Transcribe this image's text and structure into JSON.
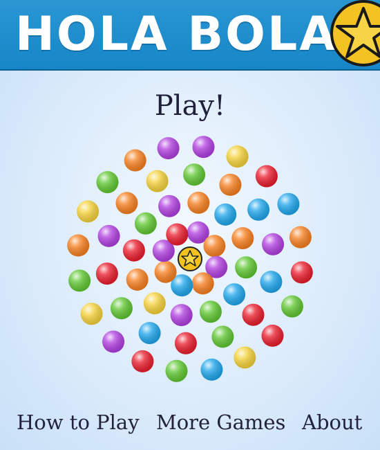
{
  "header": {
    "title": "Hola Bola!",
    "background": "#1b8bcc",
    "logo_icon": "star-ball-icon"
  },
  "main": {
    "play_label": "Play!"
  },
  "colors": {
    "violet": "#b03ee0",
    "yellow": "#f5d23a",
    "orange": "#f77f1f",
    "green": "#5fc731",
    "red": "#ea1c2c",
    "blue": "#1ea6ec",
    "center_star": "#f2c21e"
  },
  "board": {
    "center_icon": "star-ball-icon",
    "ring_colors": [
      [
        "violet",
        "orange",
        "violet",
        "orange",
        "blue",
        "orange",
        "violet",
        "red"
      ],
      [
        "orange",
        "blue",
        "orange",
        "green",
        "blue",
        "green",
        "violet",
        "yellow",
        "orange",
        "red",
        "green",
        "violet"
      ],
      [
        "green",
        "orange",
        "blue",
        "violet",
        "blue",
        "red",
        "green",
        "red",
        "blue",
        "green",
        "red",
        "violet",
        "orange",
        "yellow"
      ],
      [
        "violet",
        "yellow",
        "red",
        "blue",
        "orange",
        "red",
        "green",
        "red",
        "yellow",
        "blue",
        "green",
        "red",
        "violet",
        "yellow",
        "green",
        "orange",
        "yellow",
        "green",
        "orange",
        "violet"
      ]
    ]
  },
  "nav": {
    "how_to_play": "How to Play",
    "more_games": "More Games",
    "about": "About"
  }
}
